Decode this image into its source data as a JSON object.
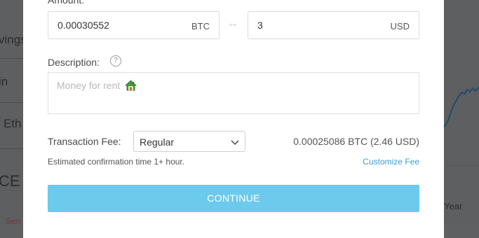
{
  "background": {
    "left_items": [
      "vings",
      "in",
      "Eth",
      "CE",
      "Sen"
    ],
    "right_label": "Year"
  },
  "modal": {
    "amount_label": "Amount:",
    "btc_value": "0.00030552",
    "btc_unit": "BTC",
    "swap_icon": "↔",
    "usd_value": "3",
    "usd_unit": "USD",
    "description_label": "Description:",
    "description_help": "?",
    "description_placeholder": "Money for rent",
    "fee_label": "Transaction Fee:",
    "fee_selected": "Regular",
    "fee_amount": "0.00025086 BTC (2.46 USD)",
    "estimate_text": "Estimated confirmation time 1+ hour.",
    "customize_fee": "Customize Fee",
    "continue_label": "CONTINUE"
  },
  "colors": {
    "accent": "#6ccaec",
    "link": "#3a9fd0",
    "overlay": "#5e5f61",
    "chart_line": "#1e4d6b"
  },
  "icons": [
    "swap-arrows-icon",
    "help-icon",
    "house-emoji-icon",
    "chevron-down-icon"
  ]
}
